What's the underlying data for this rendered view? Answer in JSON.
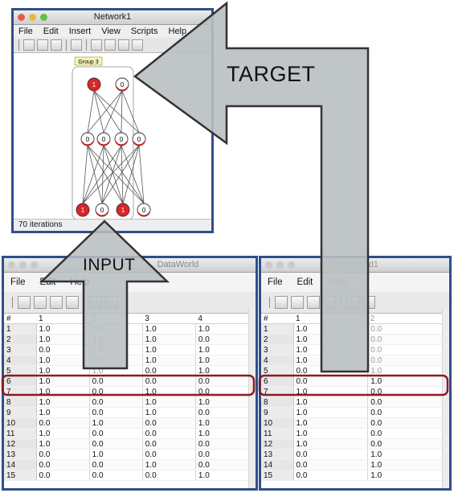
{
  "network": {
    "title": "Network1",
    "menu": [
      "File",
      "Edit",
      "Insert",
      "View",
      "Scripts",
      "Help"
    ],
    "group_label": "Group 3",
    "top_nodes": [
      "1",
      "0"
    ],
    "hidden_nodes": [
      "0",
      "0",
      "0",
      "0"
    ],
    "bottom_nodes": [
      "1",
      "0",
      "1",
      "0"
    ],
    "status": "70 iterations"
  },
  "arrows": {
    "target_label": "TARGET",
    "input_label": "INPUT"
  },
  "input_world": {
    "title": "DataWorld",
    "menu": [
      "File",
      "Edit",
      "Help"
    ],
    "columns": [
      "#",
      "1",
      "2",
      "3",
      "4"
    ],
    "rows": [
      [
        "1",
        "1.0",
        "1.0",
        "1.0",
        "1.0"
      ],
      [
        "2",
        "1.0",
        "1.0",
        "1.0",
        "0.0"
      ],
      [
        "3",
        "0.0",
        "1.0",
        "1.0",
        "1.0"
      ],
      [
        "4",
        "1.0",
        "0.0",
        "1.0",
        "1.0"
      ],
      [
        "5",
        "1.0",
        "1.0",
        "0.0",
        "1.0"
      ],
      [
        "6",
        "1.0",
        "0.0",
        "0.0",
        "0.0"
      ],
      [
        "7",
        "1.0",
        "0.0",
        "1.0",
        "0.0"
      ],
      [
        "8",
        "1.0",
        "0.0",
        "1.0",
        "1.0"
      ],
      [
        "9",
        "1.0",
        "0.0",
        "1.0",
        "0.0"
      ],
      [
        "10",
        "0.0",
        "1.0",
        "0.0",
        "1.0"
      ],
      [
        "11",
        "1.0",
        "0.0",
        "0.0",
        "1.0"
      ],
      [
        "12",
        "1.0",
        "0.0",
        "0.0",
        "0.0"
      ],
      [
        "13",
        "0.0",
        "1.0",
        "0.0",
        "0.0"
      ],
      [
        "14",
        "0.0",
        "0.0",
        "1.0",
        "0.0"
      ],
      [
        "15",
        "0.0",
        "0.0",
        "0.0",
        "1.0"
      ]
    ]
  },
  "target_world": {
    "title": "DataWorld1",
    "menu": [
      "File",
      "Edit",
      "Help"
    ],
    "columns": [
      "#",
      "1",
      "2"
    ],
    "rows": [
      [
        "1",
        "1.0",
        "0.0"
      ],
      [
        "2",
        "1.0",
        "0.0"
      ],
      [
        "3",
        "1.0",
        "0.0"
      ],
      [
        "4",
        "1.0",
        "0.0"
      ],
      [
        "5",
        "0.0",
        "1.0"
      ],
      [
        "6",
        "0.0",
        "1.0"
      ],
      [
        "7",
        "1.0",
        "0.0"
      ],
      [
        "8",
        "1.0",
        "0.0"
      ],
      [
        "9",
        "1.0",
        "0.0"
      ],
      [
        "10",
        "1.0",
        "0.0"
      ],
      [
        "11",
        "1.0",
        "0.0"
      ],
      [
        "12",
        "1.0",
        "0.0"
      ],
      [
        "13",
        "0.0",
        "1.0"
      ],
      [
        "14",
        "0.0",
        "1.0"
      ],
      [
        "15",
        "0.0",
        "1.0"
      ]
    ]
  },
  "highlight_row": "7",
  "colors": {
    "frame": "#2f4f8a",
    "arrow_fill": "#b9bfc2",
    "highlight_outline": "#8b1a24",
    "active_node": "#d8262a",
    "node_ring": "#cc2222"
  }
}
